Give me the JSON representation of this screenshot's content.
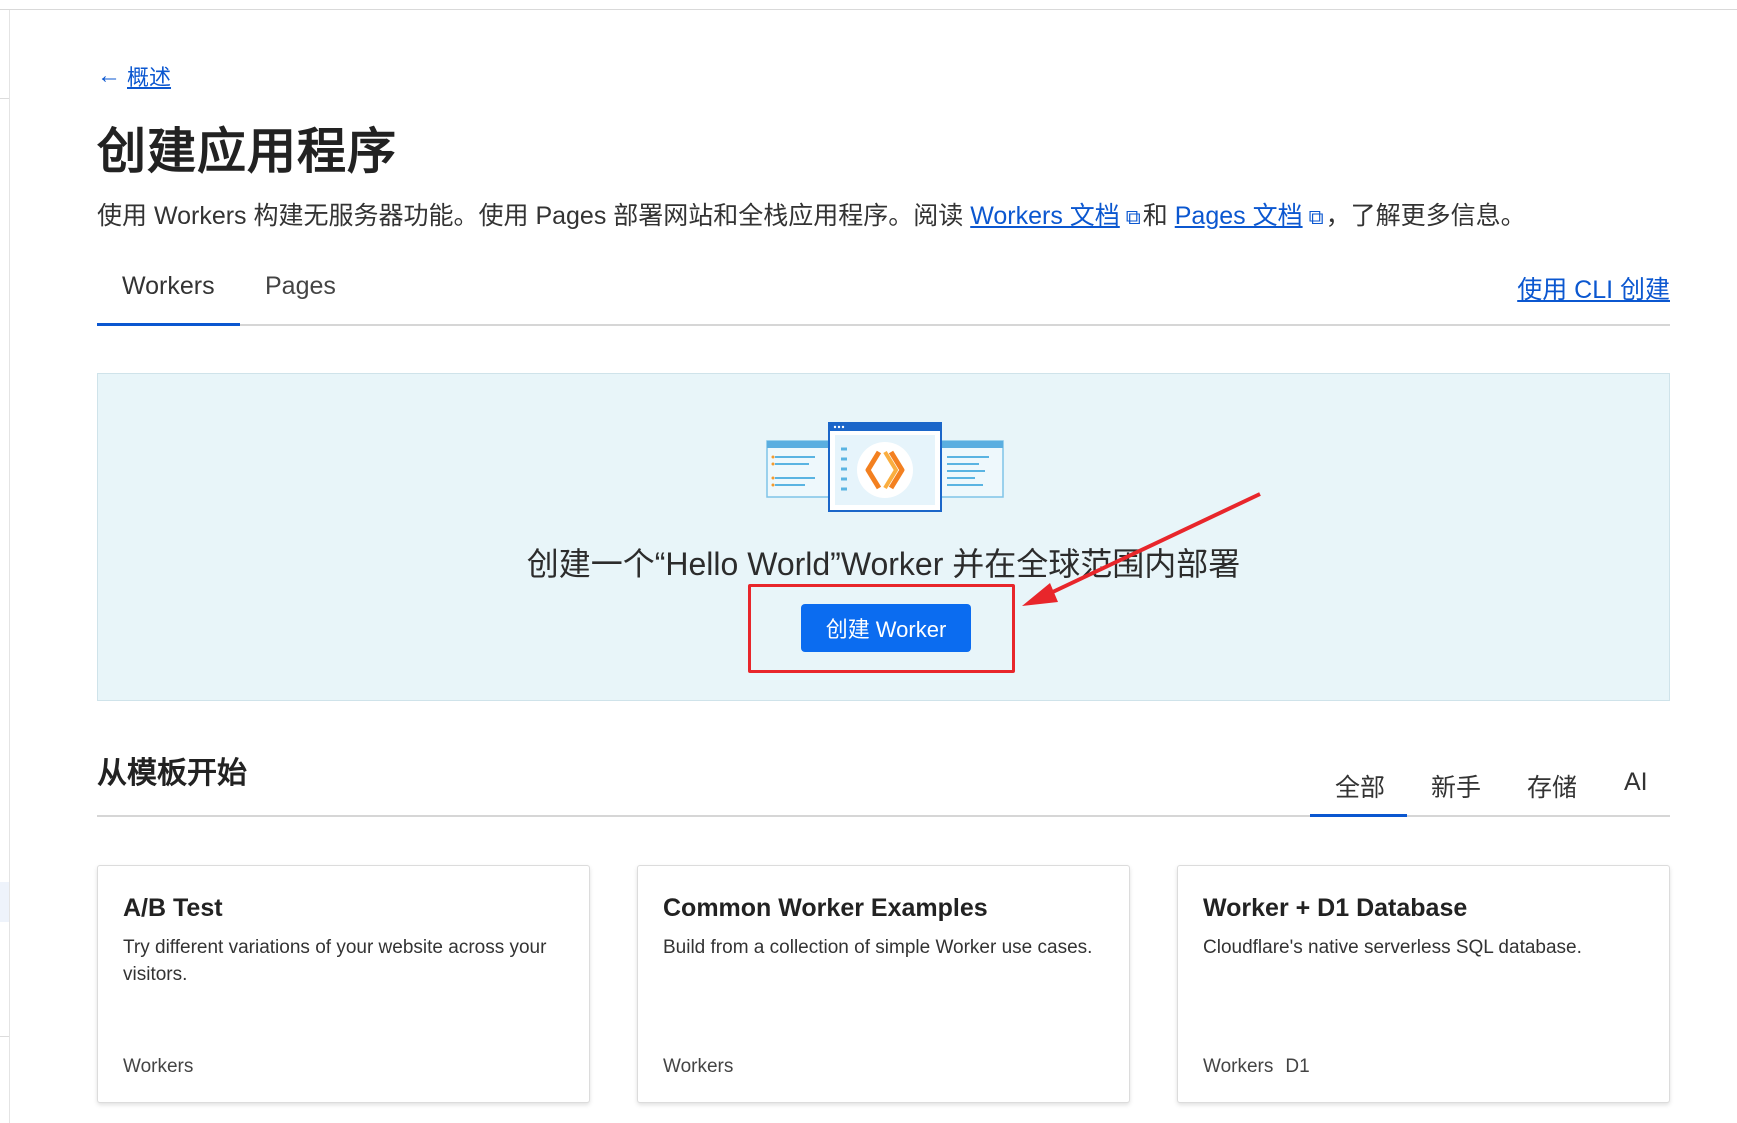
{
  "nav": {
    "back_label": "概述"
  },
  "page": {
    "title": "创建应用程序",
    "desc_prefix": "使用 Workers 构建无服务器功能。使用 Pages 部署网站和全栈应用程序。阅读 ",
    "workers_docs_link": "Workers 文档",
    "desc_middle": "和 ",
    "pages_docs_link": "Pages 文档",
    "desc_suffix": "，了解更多信息。"
  },
  "tabs": {
    "workers": "Workers",
    "pages": "Pages",
    "cli_link": "使用 CLI 创建"
  },
  "hero": {
    "text": "创建一个“Hello World”Worker 并在全球范围内部署",
    "button_label": "创建 Worker"
  },
  "templates": {
    "section_title": "从模板开始",
    "filters": [
      "全部",
      "新手",
      "存储",
      "AI"
    ],
    "cards": [
      {
        "title": "A/B Test",
        "description": "Try different variations of your website across your visitors.",
        "tags": [
          "Workers"
        ]
      },
      {
        "title": "Common Worker Examples",
        "description": "Build from a collection of simple Worker use cases.",
        "tags": [
          "Workers"
        ]
      },
      {
        "title": "Worker + D1 Database",
        "description": "Cloudflare's native serverless SQL database.",
        "tags": [
          "Workers",
          "D1"
        ]
      }
    ]
  },
  "colors": {
    "accent": "#0b57d0",
    "button": "#0b6cf0",
    "hero_bg": "#e8f5f9",
    "annotation_red": "#e8262b"
  },
  "icons": {
    "back": "arrow-left-icon",
    "external": "external-link-icon",
    "hero": "workers-code-illustration"
  }
}
